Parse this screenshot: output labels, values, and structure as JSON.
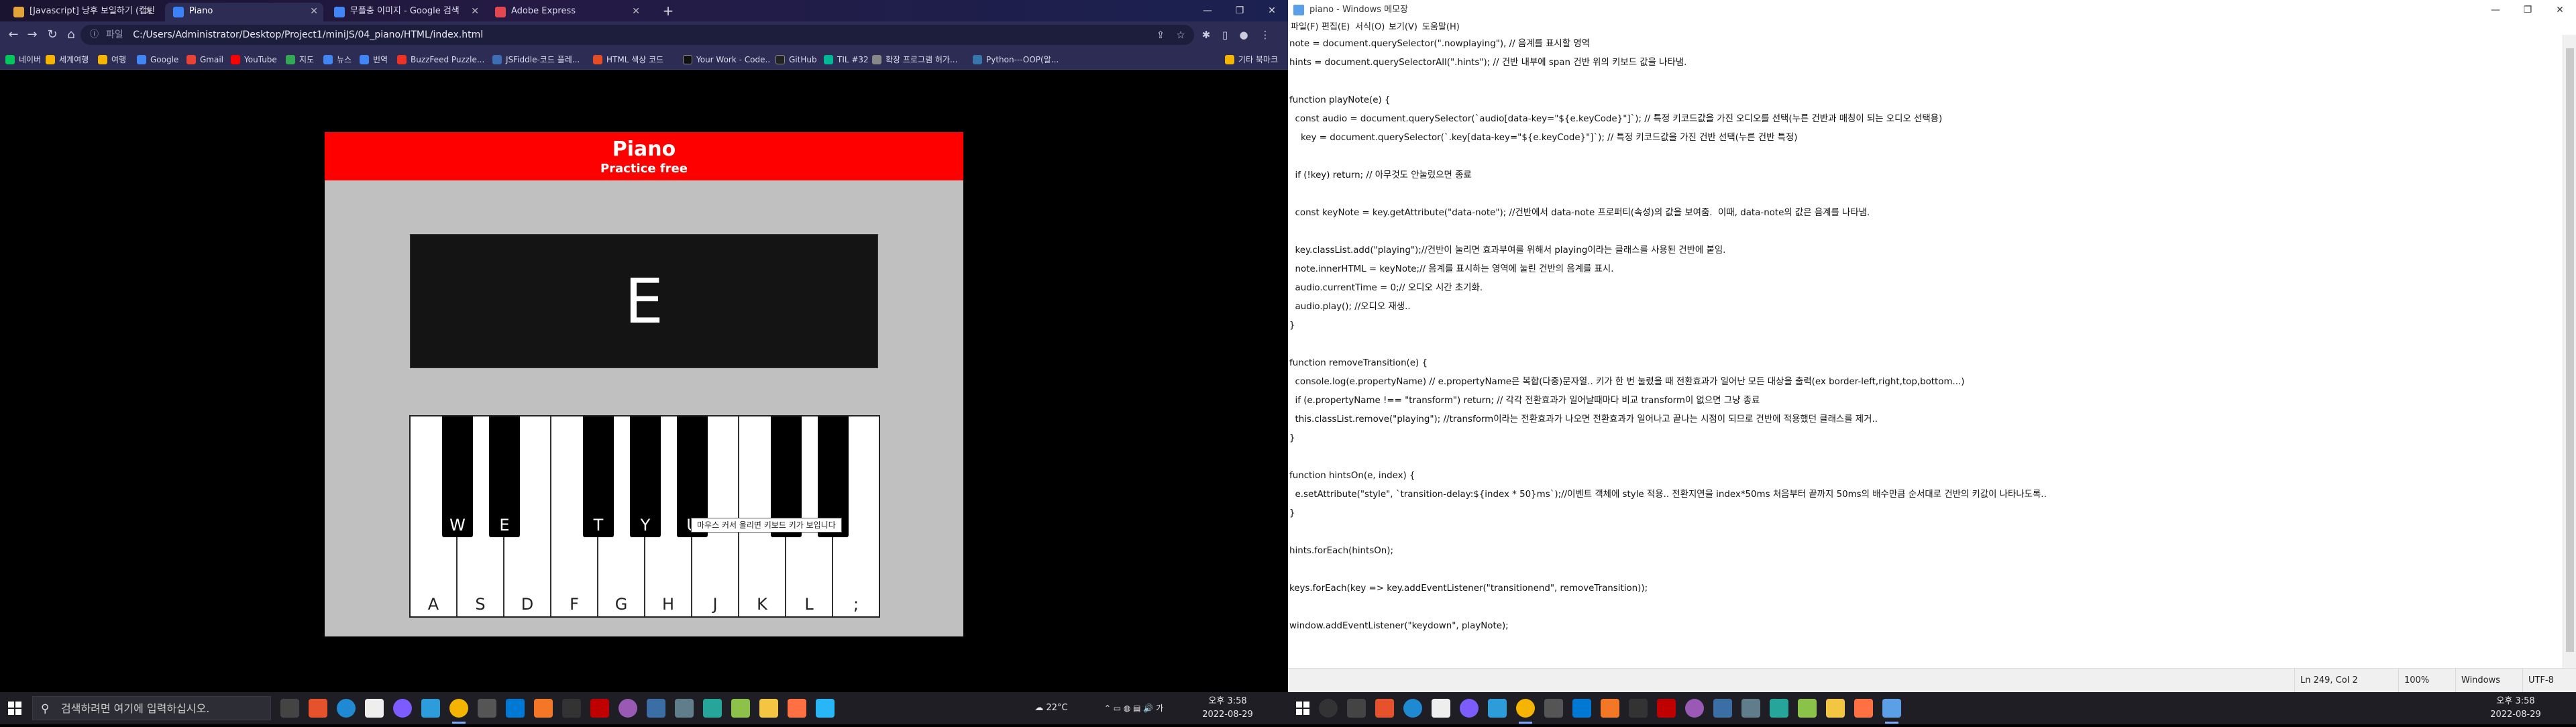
{
  "browser": {
    "tabs": [
      {
        "title": "[Javascript] 낭후 보일하기 (캡틴",
        "color": "#e3a33b"
      },
      {
        "title": "Piano",
        "color": "#3b82f6",
        "active": true
      },
      {
        "title": "무플충 이미지 - Google 검색",
        "color": "#4285f4"
      },
      {
        "title": "Adobe Express",
        "color": "#e34850"
      }
    ],
    "omnibox": {
      "scheme": "파일",
      "url": "C:/Users/Administrator/Desktop/Project1/miniJS/04_piano/HTML/index.html"
    },
    "bookmarks": [
      {
        "label": "네이버",
        "color": "#03c75a"
      },
      {
        "label": "세계여행",
        "color": "#f4b400"
      },
      {
        "label": "여행",
        "color": "#f4b400"
      },
      {
        "label": "Google",
        "color": "#4285f4"
      },
      {
        "label": "Gmail",
        "color": "#ea4335"
      },
      {
        "label": "YouTube",
        "color": "#ff0000"
      },
      {
        "label": "지도",
        "color": "#34a853"
      },
      {
        "label": "뉴스",
        "color": "#4285f4"
      },
      {
        "label": "번역",
        "color": "#4285f4"
      },
      {
        "label": "BuzzFeed Puzzle...",
        "color": "#ee3322"
      },
      {
        "label": "JSFiddle-코드 플레...",
        "color": "#3d6db3"
      },
      {
        "label": "HTML 색상 코드",
        "color": "#e44d26"
      },
      {
        "label": "Your Work - Code...",
        "color": "#111111"
      },
      {
        "label": "GitHub",
        "color": "#222222"
      },
      {
        "label": "TIL #32",
        "color": "#00b894"
      },
      {
        "label": "확장 프로그램 허가...",
        "color": "#888888"
      },
      {
        "label": "Python---OOP(알...",
        "color": "#3776ab"
      }
    ],
    "other_bookmarks": "기타 북마크"
  },
  "piano": {
    "title": "Piano",
    "subtitle": "Practice free",
    "display_note": "E",
    "white_keys": [
      "A",
      "S",
      "D",
      "F",
      "G",
      "H",
      "J",
      "K",
      "L",
      ";"
    ],
    "black_keys": [
      "W",
      "E",
      "",
      "T",
      "Y",
      "U",
      "",
      "O",
      "P"
    ],
    "tooltip": "마우스 커서 올리면 키보드 키가 보입니다"
  },
  "taskbar_left": {
    "search_placeholder": "검색하려면 여기에 입력하십시오.",
    "weather": "22°C",
    "time": "오후 3:58",
    "date": "2022-08-29"
  },
  "notepad": {
    "title": "piano - Windows 메모장",
    "menu": [
      "파일(F)",
      "편집(E)",
      "서식(O)",
      "보기(V)",
      "도움말(H)"
    ],
    "lines": [
      "note = document.querySelector(\".nowplaying\"), // 음계를 표시할 영역",
      "hints = document.querySelectorAll(\".hints\"); // 건반 내부에 span 건반 위의 키보드 값을 나타냄.",
      "",
      "function playNote(e) {",
      "  const audio = document.querySelector(`audio[data-key=\"${e.keyCode}\"]`); // 특정 키코드값을 가진 오디오를 선택(누른 건반과 매칭이 되는 오디오 선택용)",
      "    key = document.querySelector(`.key[data-key=\"${e.keyCode}\"]`); // 특정 키코드값을 가진 건반 선택(누른 건반 특정)",
      "",
      "  if (!key) return; // 아무것도 안눌렀으면 종료",
      "",
      "  const keyNote = key.getAttribute(\"data-note\"); //건반에서 data-note 프로퍼티(속성)의 값을 보여줌.  이때, data-note의 값은 음계를 나타냄.",
      "",
      "  key.classList.add(\"playing\");//건반이 눌리면 효과부여를 위해서 playing이라는 클래스를 사용된 건반에 붙임.",
      "  note.innerHTML = keyNote;// 음계를 표시하는 영역에 눌린 건반의 음계를 표시.",
      "  audio.currentTime = 0;// 오디오 시간 초기화.",
      "  audio.play(); //오디오 재생..",
      "}",
      "",
      "function removeTransition(e) {",
      "  console.log(e.propertyName) // e.propertyName은 복합(다중)문자열.. 키가 한 번 눌렸을 때 전환효과가 일어난 모든 대상을 출력(ex border-left,right,top,bottom...)",
      "  if (e.propertyName !== \"transform\") return; // 각각 전환효과가 일어날때마다 비교 transform이 없으면 그냥 종료",
      "  this.classList.remove(\"playing\"); //transform이라는 전환효과가 나오면 전환효과가 일어나고 끝나는 시점이 되므로 건반에 적용했던 클래스를 제거..",
      "}",
      "",
      "function hintsOn(e, index) {",
      "  e.setAttribute(\"style\", `transition-delay:${index * 50}ms`);//이벤트 객체에 style 적용.. 전환지연을 index*50ms 처음부터 끝까지 50ms의 배수만큼 순서대로 건반의 키값이 나타나도록..",
      "}",
      "",
      "hints.forEach(hintsOn);",
      "",
      "keys.forEach(key => key.addEventListener(\"transitionend\", removeTransition));",
      "",
      "window.addEventListener(\"keydown\", playNote);"
    ],
    "status": {
      "position": "Ln 249, Col 2",
      "zoom": "100%",
      "eol": "Windows (CRLF)",
      "encoding": "UTF-8"
    }
  },
  "taskbar_right": {
    "time": "오후 3:58",
    "date": "2022-08-29"
  }
}
